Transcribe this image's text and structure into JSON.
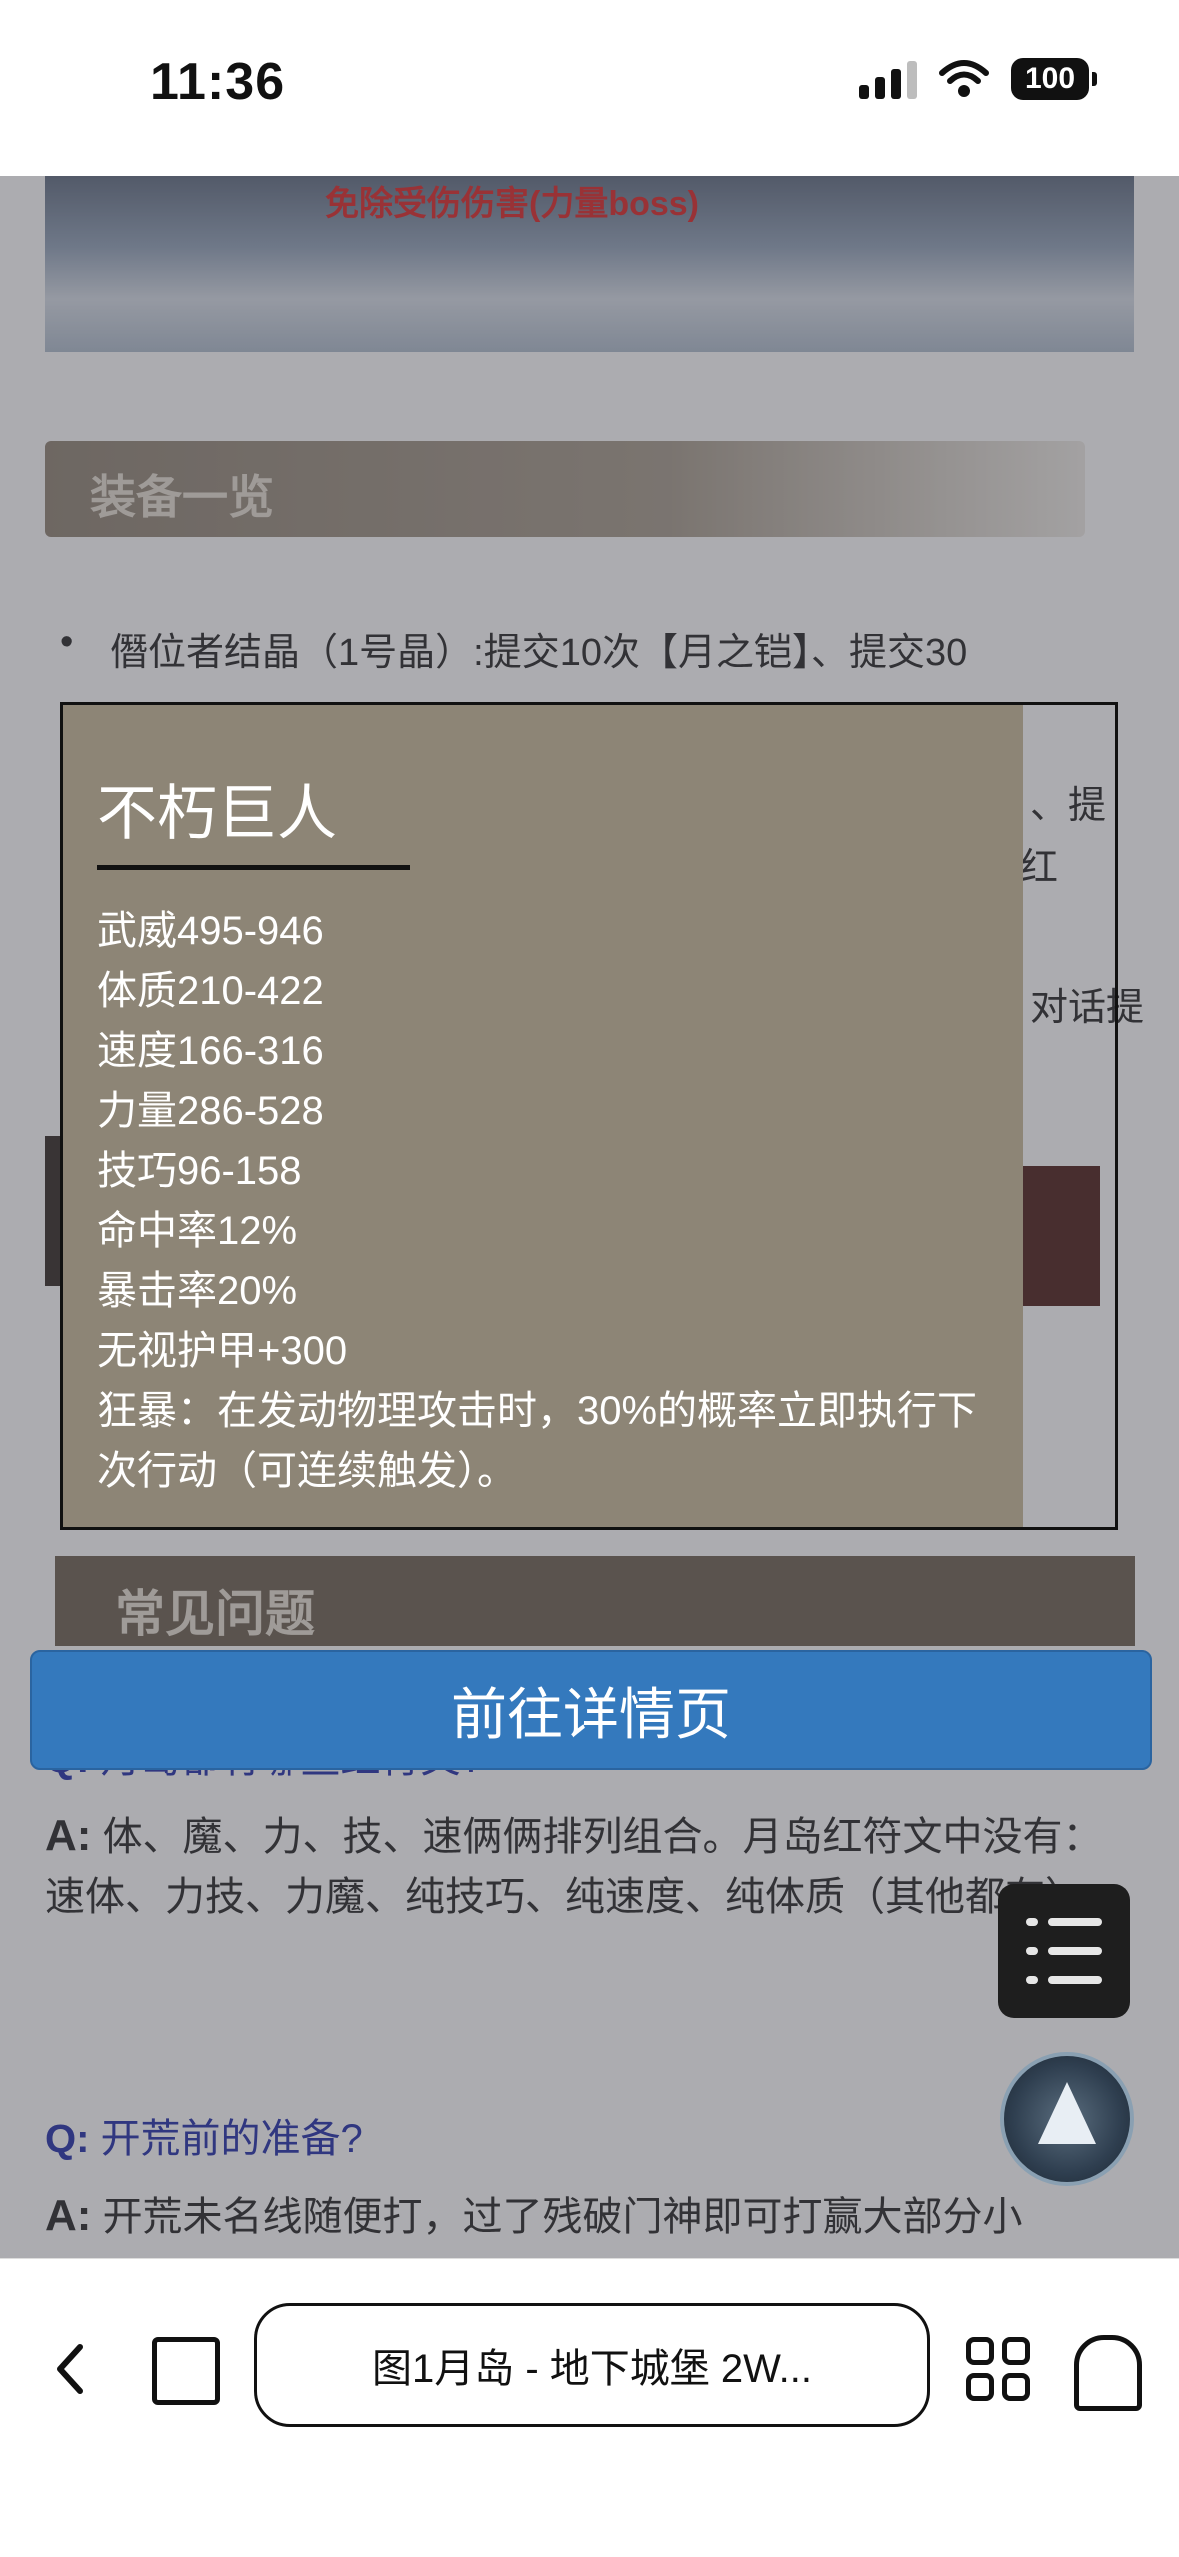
{
  "status_bar": {
    "time": "11:36",
    "battery": "100"
  },
  "page": {
    "hero_caption": "免除受伤伤害(力量boss)",
    "section_title": "装备一览",
    "bullet_text": "僭位者结晶（1号晶）:提交10次【月之铠】、提交30",
    "right_fragments": [
      "、提",
      "红",
      "对话提"
    ],
    "banner_text": "常见问题",
    "qa": [
      {
        "q_prefix": "Q:",
        "question": "月岛都有哪些红符文?",
        "a_prefix": "A:",
        "answer": "体、魔、力、技、速俩俩排列组合。月岛红符文中没有：速体、力技、力魔、纯技巧、纯速度、纯体质（其他都有）"
      },
      {
        "q_prefix": "Q:",
        "question": "开荒前的准备?",
        "a_prefix": "A:",
        "answer": "开荒未名线随便打，过了残破门神即可打赢大部分小"
      }
    ]
  },
  "tooltip": {
    "title": "不朽巨人",
    "stats": [
      "武威495-946",
      "体质210-422",
      "速度166-316",
      "力量286-528",
      "技巧96-158",
      "命中率12%",
      "暴击率20%",
      "无视护甲+300",
      "狂暴：在发动物理攻击时，30%的概率立即执行下次行动（可连续触发）。"
    ]
  },
  "detail_button": {
    "label": "前往详情页"
  },
  "bottom_bar": {
    "url_text": "图1月岛 - 地下城堡 2W..."
  }
}
